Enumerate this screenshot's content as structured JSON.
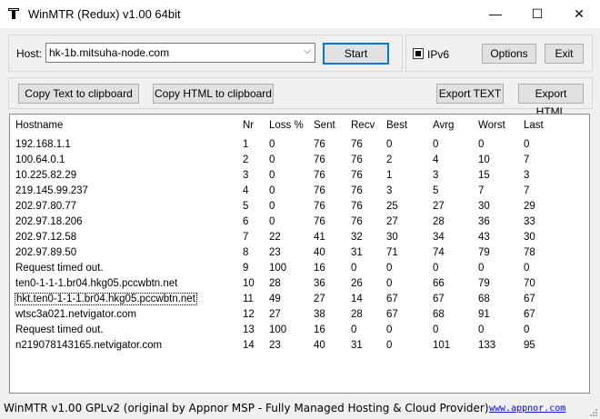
{
  "window": {
    "title": "WinMTR (Redux) v1.00 64bit",
    "minimize": "—",
    "maximize": "☐",
    "close": "✕"
  },
  "host": {
    "label": "Host:",
    "value": "hk-1b.mitsuha-node.com",
    "start_label": "Start",
    "ipv6_label": "IPv6",
    "ipv6_checked": true,
    "options_label": "Options",
    "exit_label": "Exit"
  },
  "toolbar": {
    "copy_text_label": "Copy Text to clipboard",
    "copy_html_label": "Copy HTML to clipboard",
    "export_text_label": "Export TEXT",
    "export_html_label": "Export HTML"
  },
  "table": {
    "columns": [
      "Hostname",
      "Nr",
      "Loss %",
      "Sent",
      "Recv",
      "Best",
      "Avrg",
      "Worst",
      "Last"
    ],
    "rows": [
      [
        "192.168.1.1",
        "1",
        "0",
        "76",
        "76",
        "0",
        "0",
        "0",
        "0"
      ],
      [
        "100.64.0.1",
        "2",
        "0",
        "76",
        "76",
        "2",
        "4",
        "10",
        "7"
      ],
      [
        "10.225.82.29",
        "3",
        "0",
        "76",
        "76",
        "1",
        "3",
        "15",
        "3"
      ],
      [
        "219.145.99.237",
        "4",
        "0",
        "76",
        "76",
        "3",
        "5",
        "7",
        "7"
      ],
      [
        "202.97.80.77",
        "5",
        "0",
        "76",
        "76",
        "25",
        "27",
        "30",
        "29"
      ],
      [
        "202.97.18.206",
        "6",
        "0",
        "76",
        "76",
        "27",
        "28",
        "36",
        "33"
      ],
      [
        "202.97.12.58",
        "7",
        "22",
        "41",
        "32",
        "30",
        "34",
        "43",
        "30"
      ],
      [
        "202.97.89.50",
        "8",
        "23",
        "40",
        "31",
        "71",
        "74",
        "79",
        "78"
      ],
      [
        "Request timed out.",
        "9",
        "100",
        "16",
        "0",
        "0",
        "0",
        "0",
        "0"
      ],
      [
        "ten0-1-1-1.br04.hkg05.pccwbtn.net",
        "10",
        "28",
        "36",
        "26",
        "0",
        "66",
        "79",
        "70"
      ],
      [
        "hkt.ten0-1-1-1.br04.hkg05.pccwbtn.net",
        "11",
        "49",
        "27",
        "14",
        "67",
        "67",
        "68",
        "67"
      ],
      [
        "wtsc3a021.netvigator.com",
        "12",
        "27",
        "38",
        "28",
        "67",
        "68",
        "91",
        "67"
      ],
      [
        "Request timed out.",
        "13",
        "100",
        "16",
        "0",
        "0",
        "0",
        "0",
        "0"
      ],
      [
        "n219078143165.netvigator.com",
        "14",
        "23",
        "40",
        "31",
        "0",
        "101",
        "133",
        "95"
      ]
    ],
    "selected_row": 10
  },
  "status": {
    "text": "WinMTR v1.00 GPLv2 (original by Appnor MSP - Fully Managed Hosting & Cloud Provider)",
    "link": "www.appnor.com"
  }
}
